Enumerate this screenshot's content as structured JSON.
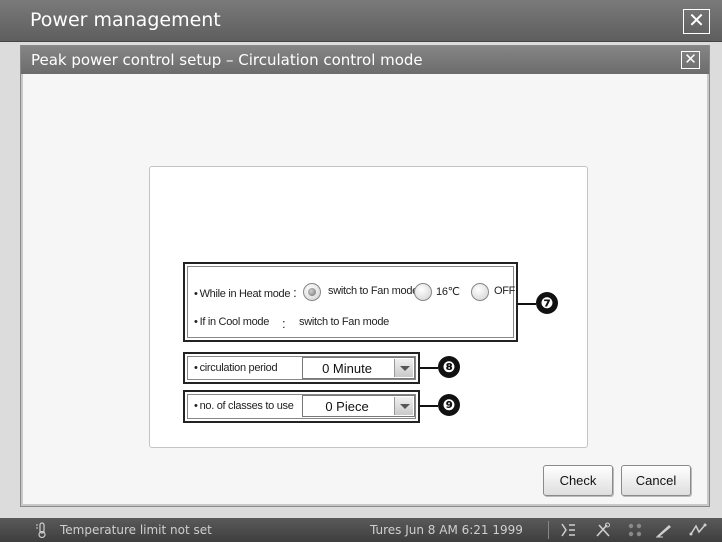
{
  "app": {
    "title": "Power management",
    "close_glyph": "✕"
  },
  "dialog": {
    "title": "Peak power control setup – Circulation control mode",
    "close_glyph": "✕"
  },
  "heat_mode": {
    "label": "While in Heat mode",
    "colon": ":",
    "options": [
      {
        "label": "switch to Fan mode",
        "selected": true
      },
      {
        "label": "16℃",
        "selected": false
      },
      {
        "label": "OFF",
        "selected": false
      }
    ]
  },
  "cool_mode": {
    "label": "If in Cool mode",
    "colon": ":",
    "value": "switch to Fan mode"
  },
  "circulation_period": {
    "label": "circulation period",
    "value": "0 Minute"
  },
  "classes": {
    "label": "no. of classes to use",
    "value": "0 Piece"
  },
  "callouts": [
    "❼",
    "❽",
    "❾"
  ],
  "bullet": "•",
  "buttons": {
    "check": "Check",
    "cancel": "Cancel"
  },
  "status": {
    "message": "Temperature limit not set",
    "datetime": "Tures Jun 8 AM 6:21 1999",
    "tray_icons": [
      "thermometer-icon",
      "list-icon",
      "tools-icon",
      "dots-icon",
      "pen-icon",
      "network-icon"
    ]
  }
}
